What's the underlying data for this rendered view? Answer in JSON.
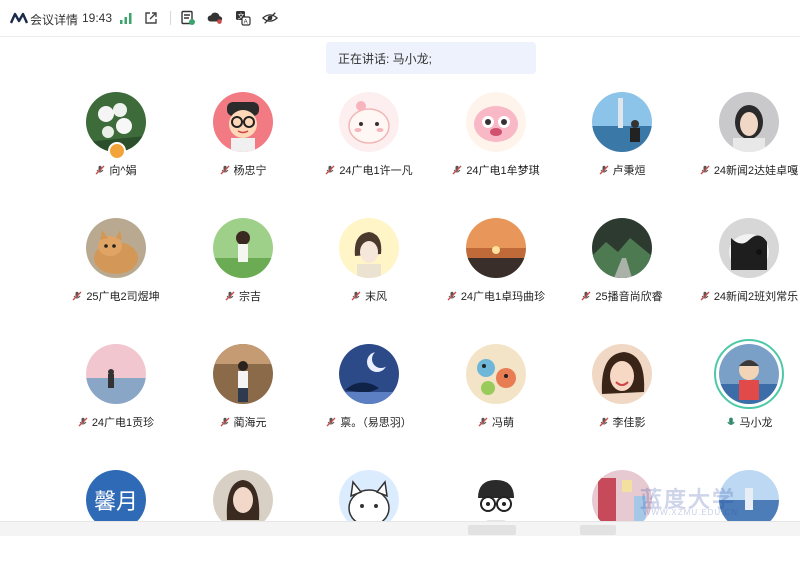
{
  "header": {
    "title": "会议详情",
    "time": "19:43"
  },
  "speaker_banner": {
    "text": "正在讲话: 马小龙;"
  },
  "participants": [
    {
      "name": "向^娟",
      "avatar": "flower-photo",
      "muted": true,
      "host": true
    },
    {
      "name": "杨忠宁",
      "avatar": "cartoon-glasses-boy",
      "muted": true
    },
    {
      "name": "24广电1许一凡",
      "avatar": "pink-cat-cartoon",
      "muted": true
    },
    {
      "name": "24广电1牟梦琪",
      "avatar": "pink-creature-cartoon",
      "muted": true
    },
    {
      "name": "卢秉烜",
      "avatar": "seaside-tower-photo",
      "muted": true
    },
    {
      "name": "24新闻2达娃卓嘎",
      "avatar": "girl-selfie-photo",
      "muted": true
    },
    {
      "name": "25广电2司煜坤",
      "avatar": "cat-photo",
      "muted": true
    },
    {
      "name": "宗吉",
      "avatar": "girl-field-photo",
      "muted": true
    },
    {
      "name": "末风",
      "avatar": "girl-sketch",
      "muted": true
    },
    {
      "name": "24广电1卓玛曲珍",
      "avatar": "sunset-photo",
      "muted": true
    },
    {
      "name": "25播音尚欣睿",
      "avatar": "mountain-road-photo",
      "muted": true
    },
    {
      "name": "24新闻2班刘常乐",
      "avatar": "dog-photo",
      "muted": true
    },
    {
      "name": "24广电1贡珍",
      "avatar": "pink-sea-photo",
      "muted": true
    },
    {
      "name": "蔺海元",
      "avatar": "man-standing-photo",
      "muted": true
    },
    {
      "name": "禀。（易思羽）",
      "avatar": "whale-moon-art",
      "muted": true
    },
    {
      "name": "冯萌",
      "avatar": "cartoon-collage",
      "muted": true
    },
    {
      "name": "李佳影",
      "avatar": "girl-laughing-photo",
      "muted": true
    },
    {
      "name": "马小龙",
      "avatar": "kid-photo",
      "muted": false,
      "speaking": true
    },
    {
      "name": "",
      "avatar": "text-avatar",
      "avatar_text": "馨月"
    },
    {
      "name": "",
      "avatar": "woman-photo"
    },
    {
      "name": "",
      "avatar": "cat-cartoon-white"
    },
    {
      "name": "",
      "avatar": "glasses-cartoon"
    },
    {
      "name": "",
      "avatar": "toy-shop-photo"
    },
    {
      "name": "",
      "avatar": "blue-ocean-photo"
    }
  ],
  "watermark": {
    "main": "蓝度大学",
    "sub": "WWW.XZMU.EDU.CN"
  },
  "colors": {
    "accent_green": "#4fc8a8",
    "host_badge": "#f2a43a",
    "banner_bg": "#eef2fc",
    "mic_muted": "#c84a4a"
  }
}
